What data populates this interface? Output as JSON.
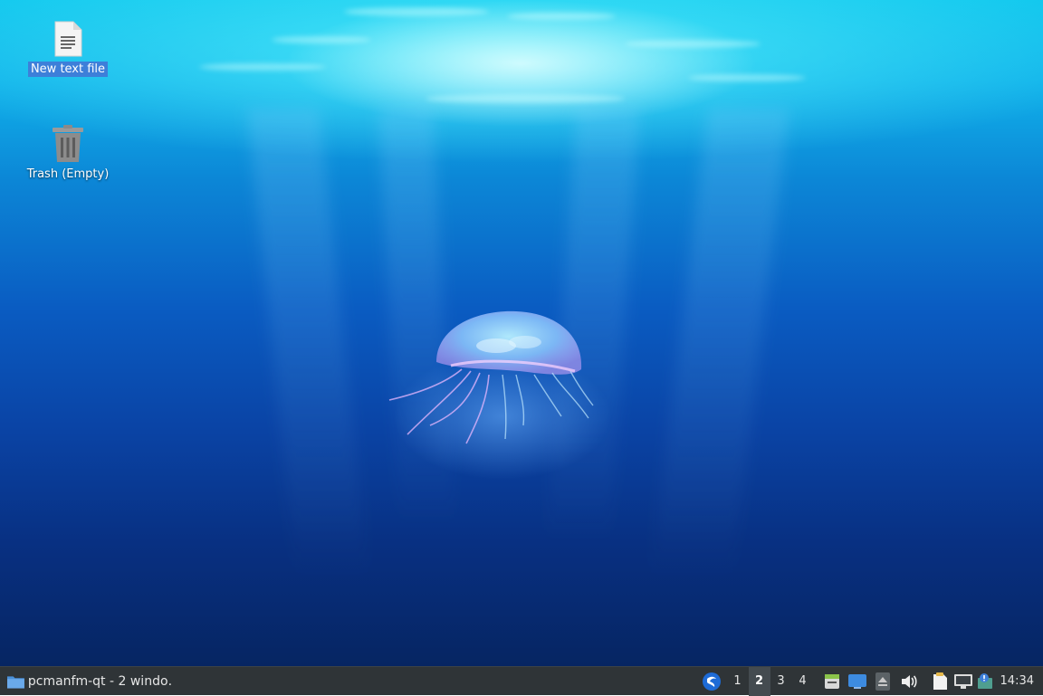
{
  "desktop": {
    "icons": [
      {
        "label": "New text file",
        "icon": "text-file-icon",
        "selected": true
      },
      {
        "label": "Trash (Empty)",
        "icon": "trash-icon",
        "selected": false
      }
    ],
    "wallpaper": "jellyfish-underwater"
  },
  "taskbar": {
    "task": {
      "label": "pcmanfm-qt - 2 windo…",
      "icon": "folder-icon"
    },
    "workspaces": [
      "1",
      "2",
      "3",
      "4"
    ],
    "active_workspace": "2",
    "tray_icons": [
      "lxqt-menu-icon",
      "clipboard-manager-icon",
      "show-desktop-icon",
      "eject-icon",
      "volume-icon",
      "notes-icon",
      "network-icon",
      "update-notifier-icon"
    ],
    "clock": "14:34",
    "colors": {
      "panel": "#2f3437",
      "selection": "#3d7fd9"
    }
  }
}
